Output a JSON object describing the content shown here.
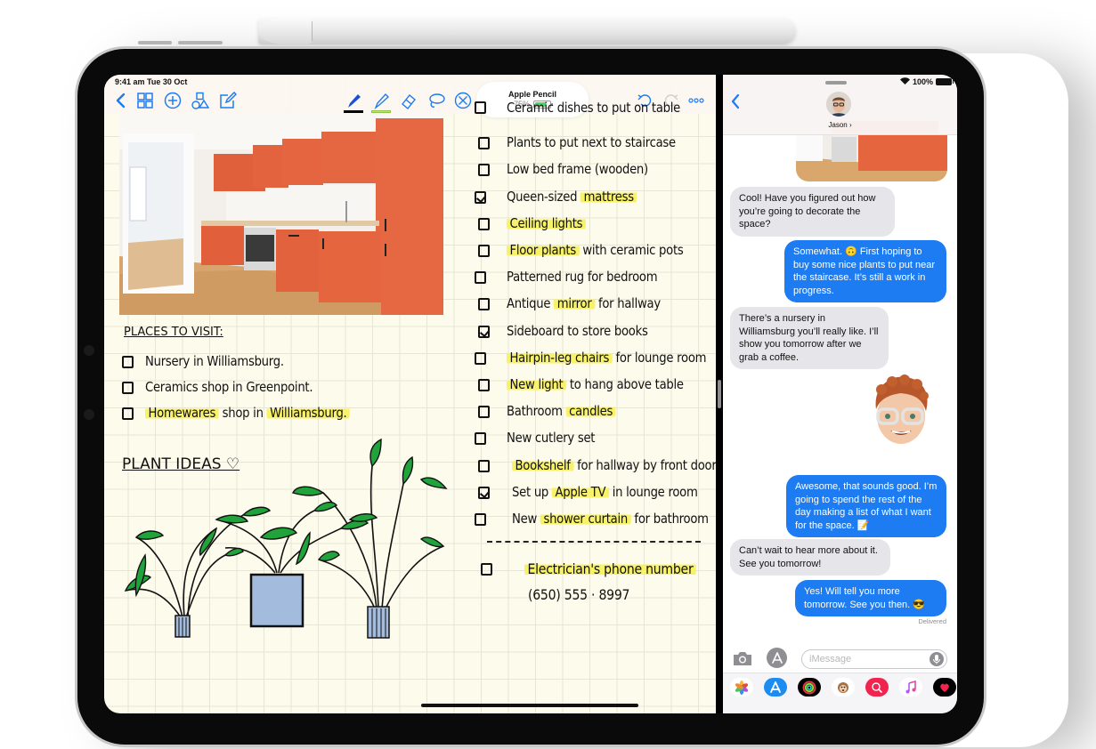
{
  "accessory": {
    "name": "Apple Pencil",
    "battery": "75%",
    "battery_level": 0.75
  },
  "notes": {
    "status_time": "9:41 am  Tue 30 Oct",
    "toolbar": {
      "left_icons": [
        "back-chevron-icon",
        "grid-icon",
        "add-circle-icon",
        "shapes-icon",
        "compose-icon"
      ],
      "tools": [
        "pen-tool",
        "highlighter-tool",
        "eraser-tool",
        "lasso-tool",
        "close-circle-icon"
      ],
      "right_icons": [
        "undo-icon",
        "redo-icon",
        "more-icon"
      ],
      "pen_color": "#000000",
      "highlighter_color": "#d4e157"
    },
    "places_heading": "PLACES TO VISIT:",
    "places": [
      {
        "text": "Nursery in Williamsburg.",
        "checked": false
      },
      {
        "text_pre": "",
        "highlight": "Ceramics shop in",
        "text": "Ceramics shop in  Greenpoint.",
        "checked": false
      },
      {
        "highlight": "Homewares",
        "rest": " shop in ",
        "highlight2": "Williamsburg.",
        "checked": false
      }
    ],
    "plant_heading": "PLANT IDEAS ♡",
    "checklist": [
      {
        "pre": "",
        "highlight": "",
        "post": "Ceramic dishes to put on table",
        "checked": false
      },
      {
        "pre": "Plants to put next to staircase",
        "highlight": "",
        "post": "",
        "checked": false
      },
      {
        "pre": "Low bed frame (wooden)",
        "highlight": "",
        "post": "",
        "checked": false
      },
      {
        "pre": "Queen-sized ",
        "highlight": "mattress",
        "post": "",
        "checked": true
      },
      {
        "pre": "",
        "highlight": "Ceiling lights",
        "post": "",
        "checked": false
      },
      {
        "pre": "",
        "highlight": "Floor plants",
        "post": " with ceramic pots",
        "checked": false
      },
      {
        "pre": "Patterned rug for bedroom",
        "highlight": "",
        "post": "",
        "checked": false
      },
      {
        "pre": "Antique ",
        "highlight": "mirror",
        "post": " for hallway",
        "checked": false
      },
      {
        "pre": "Sideboard to store books",
        "highlight": "",
        "post": "",
        "checked": true
      },
      {
        "pre": "",
        "highlight": "Hairpin-leg chairs",
        "post": " for lounge room",
        "checked": false
      },
      {
        "pre": "",
        "highlight": "New light",
        "post": " to hang above table",
        "checked": false
      },
      {
        "pre": "Bathroom ",
        "highlight": "candles",
        "post": "",
        "checked": false
      },
      {
        "pre": "New cutlery set",
        "highlight": "",
        "post": "",
        "checked": false
      },
      {
        "pre": "",
        "highlight": "Bookshelf",
        "post": " for hallway by front door",
        "checked": false
      },
      {
        "pre": "Set up ",
        "highlight": "Apple TV",
        "post": " in lounge room",
        "checked": true
      },
      {
        "pre": "New ",
        "highlight": "shower curtain",
        "post": " for bathroom",
        "checked": false
      }
    ],
    "electrician": {
      "highlight": "Electrician's phone number",
      "phone": "(650) 555 · 8997",
      "checked": false
    }
  },
  "messages": {
    "status": {
      "battery": "100%"
    },
    "contact": "Jason ›",
    "thread": [
      {
        "dir": "in",
        "text": "Cool! Have you figured out how you’re going to decorate the space?"
      },
      {
        "dir": "out",
        "text": "Somewhat. 🙃 First hoping to buy some nice plants to put near the staircase. It’s still a work in progress."
      },
      {
        "dir": "in",
        "text": "There’s a nursery in Williamsburg you’ll really like. I’ll show you tomorrow after we grab a coffee."
      },
      {
        "dir": "in",
        "type": "memoji",
        "text": ""
      },
      {
        "dir": "out",
        "text": "Awesome, that sounds good. I’m going to spend the rest of the day making a list of what I want for the space. 📝"
      },
      {
        "dir": "in",
        "text": "Can’t wait to hear more about it. See you tomorrow!"
      },
      {
        "dir": "out",
        "text": "Yes! Will tell you more tomorrow. See you then. 😎"
      }
    ],
    "delivered": "Delivered",
    "compose_placeholder": "iMessage",
    "app_drawer": [
      "photos-app-icon",
      "app-store-icon",
      "activity-icon",
      "animoji-icon",
      "images-search-icon",
      "music-icon",
      "digital-touch-icon"
    ],
    "colors": {
      "bubble_out": "#1d7cf2",
      "bubble_in": "#e5e5ea"
    }
  }
}
